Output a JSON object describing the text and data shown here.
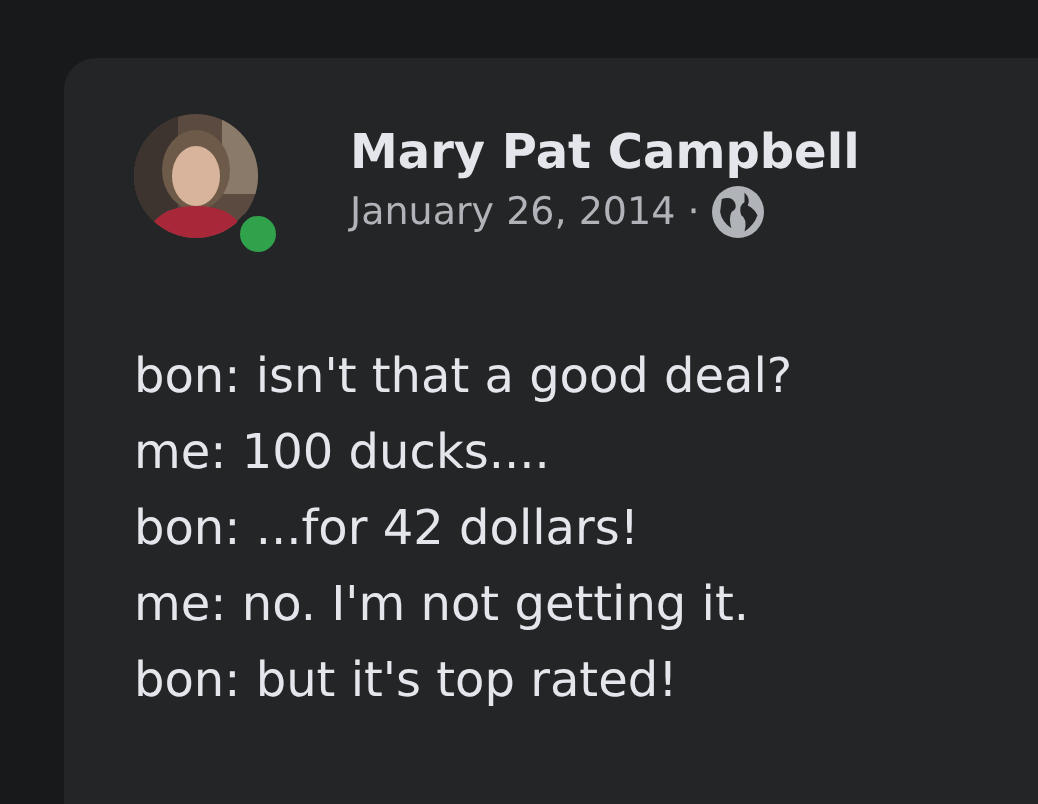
{
  "post": {
    "author": {
      "name": "Mary Pat Campbell",
      "online": true
    },
    "date": "January 26, 2014",
    "separator": "·",
    "lines": [
      "bon: isn't that a good deal?",
      "me: 100 ducks....",
      "bon: ...for 42 dollars!",
      "me: no. I'm not getting it.",
      "bon: but it's top rated!"
    ]
  }
}
